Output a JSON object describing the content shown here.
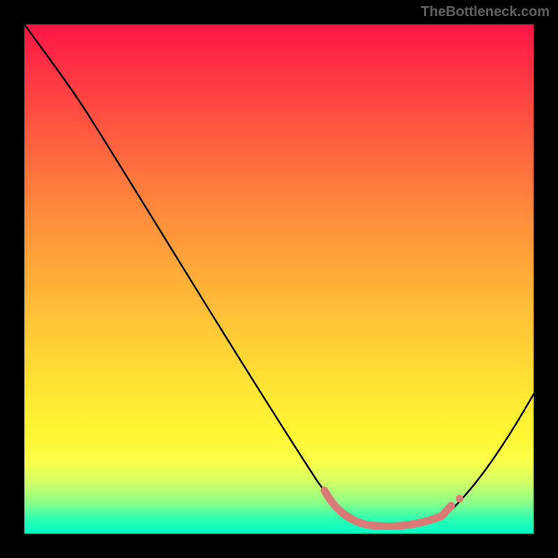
{
  "watermark": "TheBottleneck.com",
  "chart_data": {
    "type": "line",
    "title": "",
    "xlabel": "",
    "ylabel": "",
    "x": [
      0,
      5,
      13,
      25,
      41,
      58,
      69,
      75,
      80,
      84,
      90,
      100
    ],
    "values": [
      100,
      92,
      82,
      63,
      37,
      10,
      2,
      1,
      2,
      5,
      18,
      27
    ],
    "ylim": [
      0,
      100
    ],
    "xlim": [
      0,
      100
    ],
    "highlight_range_x": [
      59,
      86
    ],
    "highlight_marker_x": 85,
    "background_gradient_stops": [
      {
        "pos": 0.0,
        "color": "#ff1447"
      },
      {
        "pos": 0.08,
        "color": "#ff2f45"
      },
      {
        "pos": 0.2,
        "color": "#ff5640"
      },
      {
        "pos": 0.32,
        "color": "#ff7c3d"
      },
      {
        "pos": 0.45,
        "color": "#ffa13a"
      },
      {
        "pos": 0.58,
        "color": "#ffc437"
      },
      {
        "pos": 0.7,
        "color": "#ffe234"
      },
      {
        "pos": 0.8,
        "color": "#fff633"
      },
      {
        "pos": 0.86,
        "color": "#faff4a"
      },
      {
        "pos": 0.9,
        "color": "#d2ff66"
      },
      {
        "pos": 0.94,
        "color": "#8aff8a"
      },
      {
        "pos": 0.97,
        "color": "#2fffb0"
      },
      {
        "pos": 1.0,
        "color": "#00ffc8"
      }
    ],
    "curve_color": "#000000",
    "highlight_color": "#d97a76",
    "frame_color": "#000000"
  }
}
